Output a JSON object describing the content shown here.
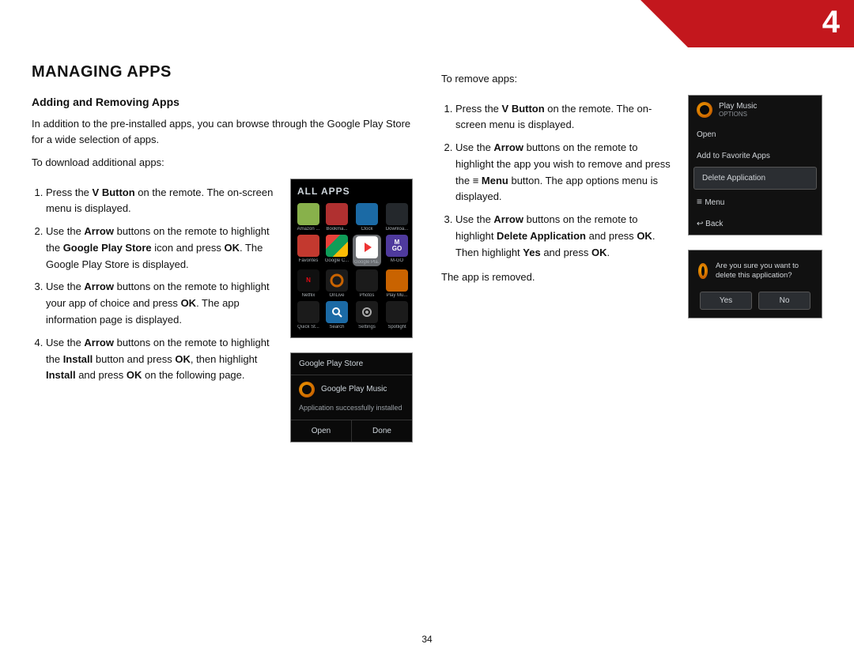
{
  "page_number": "34",
  "chapter_number": "4",
  "heading": "MANAGING APPS",
  "subheading": "Adding and Removing Apps",
  "intro": "In addition to the pre-installed apps, you can browse through the Google Play Store for a wide selection of apps.",
  "download_lead": "To download additional apps:",
  "download_steps": {
    "s1a": "Press the ",
    "s1b": "V Button",
    "s1c": " on the remote. The on-screen menu is displayed.",
    "s2a": "Use the ",
    "s2b": "Arrow",
    "s2c": " buttons on the remote to highlight the ",
    "s2d": "Google Play Store",
    "s2e": " icon and press ",
    "s2f": "OK",
    "s2g": ". The Google Play Store is displayed.",
    "s3a": "Use the ",
    "s3b": "Arrow",
    "s3c": " buttons on the remote to highlight your app of choice and press ",
    "s3d": "OK",
    "s3e": ". The app information page is displayed.",
    "s4a": "Use the ",
    "s4b": "Arrow",
    "s4c": " buttons on the remote to highlight the ",
    "s4d": "Install",
    "s4e": " button and press ",
    "s4f": "OK",
    "s4g": ", then highlight ",
    "s4h": "Install",
    "s4i": " and press ",
    "s4j": "OK",
    "s4k": " on the following page."
  },
  "remove_lead": "To remove apps:",
  "remove_steps": {
    "r1a": "Press the ",
    "r1b": "V Button",
    "r1c": " on the remote. The on-screen menu is displayed.",
    "r2a": "Use the ",
    "r2b": "Arrow",
    "r2c": " buttons on the remote to highlight the app you wish to remove and press the ",
    "r2d": "≡",
    "r2e": " ",
    "r2f": "Menu",
    "r2g": " button. The app options menu is displayed.",
    "r3a": "Use the ",
    "r3b": "Arrow",
    "r3c": " buttons on the remote to highlight ",
    "r3d": "Delete Application",
    "r3e": " and press ",
    "r3f": "OK",
    "r3g": ". Then highlight ",
    "r3h": "Yes",
    "r3i": " and press ",
    "r3j": "OK",
    "r3k": "."
  },
  "remove_done": "The app is removed.",
  "fig_allapps": {
    "title": "ALL APPS",
    "apps": [
      "Amazon ...",
      "Bookma...",
      "Clock",
      "Downloa...",
      "Favorites",
      "Google C...",
      "Google Pla...",
      "M-GO",
      "Netflix",
      "OnLive",
      "Photos",
      "Play Mu...",
      "Quick St...",
      "Search",
      "Settings",
      "Spotlight"
    ]
  },
  "fig_install": {
    "header": "Google Play Store",
    "app_name": "Google Play Music",
    "message": "Application successfully installed",
    "open": "Open",
    "done": "Done"
  },
  "fig_options": {
    "title": "Play Music",
    "subtitle": "OPTIONS",
    "open": "Open",
    "add": "Add to Favorite Apps",
    "delete": "Delete Application",
    "menu": "Menu",
    "back": "Back"
  },
  "fig_confirm": {
    "question": "Are you sure you want to delete this application?",
    "yes": "Yes",
    "no": "No"
  }
}
